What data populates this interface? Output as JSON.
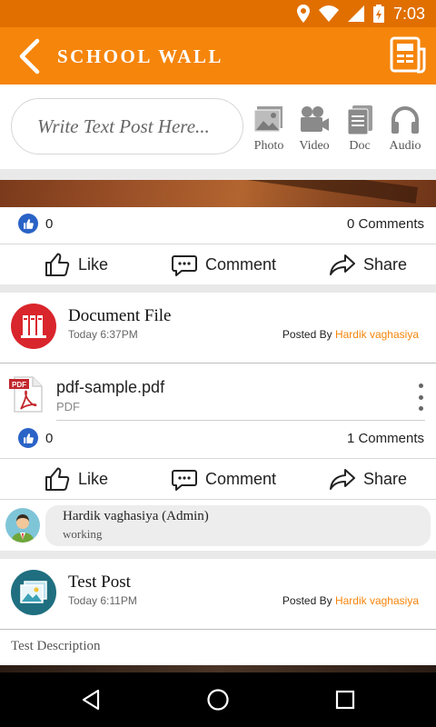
{
  "status_bar": {
    "time": "7:03"
  },
  "app_bar": {
    "title": "SCHOOL WALL"
  },
  "composer": {
    "placeholder": "Write Text Post Here...",
    "buttons": [
      {
        "label": "Photo",
        "icon": "photo-icon"
      },
      {
        "label": "Video",
        "icon": "video-camera-icon"
      },
      {
        "label": "Doc",
        "icon": "document-icon"
      },
      {
        "label": "Audio",
        "icon": "headphones-icon"
      }
    ]
  },
  "posts": [
    {
      "likes": "0",
      "comments": "0 Comments",
      "actions": {
        "like": "Like",
        "comment": "Comment",
        "share": "Share"
      }
    },
    {
      "title": "Document File",
      "time": "Today 6:37PM",
      "posted_by_label": "Posted By",
      "author": "Hardik vaghasiya",
      "file": {
        "name": "pdf-sample.pdf",
        "type": "PDF",
        "icon_label": "PDF"
      },
      "likes": "0",
      "comments": "1 Comments",
      "actions": {
        "like": "Like",
        "comment": "Comment",
        "share": "Share"
      },
      "comment": {
        "author": "Hardik vaghasiya (Admin)",
        "text": "working"
      }
    },
    {
      "title": "Test Post",
      "time": "Today 6:11PM",
      "posted_by_label": "Posted By",
      "author": "Hardik vaghasiya",
      "description": "Test Description"
    }
  ],
  "colors": {
    "status_bar": "#e06f00",
    "app_bar": "#f5850b",
    "author": "#f5850b",
    "like_badge": "#2a63c6",
    "doc_avatar": "#d9252c",
    "post_avatar": "#1f6f80"
  }
}
